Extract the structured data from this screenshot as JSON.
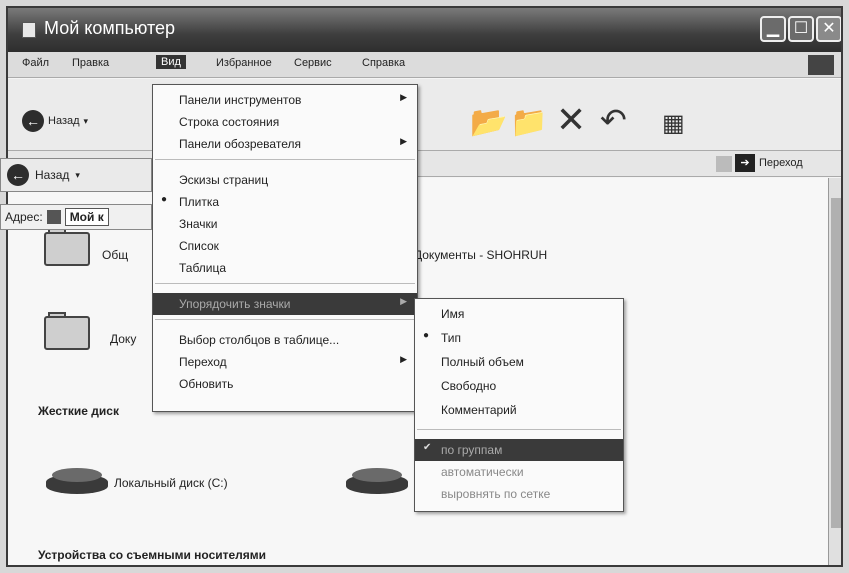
{
  "window": {
    "title": "Мой компьютер"
  },
  "menubar": {
    "items": [
      "Файл",
      "Правка",
      "Вид",
      "Избранное",
      "Сервис",
      "Справка"
    ],
    "active": "Вид"
  },
  "toolbar": {
    "back_label": "Назад"
  },
  "address": {
    "label": "Адрес:",
    "value": "Мой к",
    "go_label": "Переход"
  },
  "content": {
    "folder1": "Общ",
    "folder1_path": "Документы - SHOHRUH",
    "folder2": "Доку",
    "section_hdd": "Жесткие диск",
    "drive_c": "Локальный диск (C:)",
    "section_removable": "Устройства со съемными носителями"
  },
  "view_menu": {
    "group1": [
      {
        "label": "Панели инструментов",
        "submenu": true
      },
      {
        "label": "Строка состояния"
      },
      {
        "label": "Панели обозревателя",
        "submenu": true
      }
    ],
    "group2": [
      {
        "label": "Эскизы страниц"
      },
      {
        "label": "Плитка",
        "bullet": true
      },
      {
        "label": "Значки"
      },
      {
        "label": "Список"
      },
      {
        "label": "Таблица"
      }
    ],
    "group3": [
      {
        "label": "Упорядочить значки",
        "submenu": true,
        "highlighted": true
      }
    ],
    "group4": [
      {
        "label": "Выбор столбцов в таблице..."
      },
      {
        "label": "Переход",
        "submenu": true
      },
      {
        "label": "Обновить"
      }
    ]
  },
  "arrange_menu": {
    "sort_items": [
      {
        "label": "Имя"
      },
      {
        "label": "Тип",
        "bullet": true
      },
      {
        "label": "Полный объем"
      },
      {
        "label": "Свободно"
      },
      {
        "label": "Комментарий"
      }
    ],
    "option_items": [
      {
        "label": "по группам",
        "checked": true,
        "highlighted": true
      },
      {
        "label": "автоматически"
      },
      {
        "label": "выровнять по сетке"
      }
    ]
  },
  "glyphs": {
    "bullet": "●",
    "check": "✔",
    "submenu_arrow": "▶",
    "back_arrow": "←",
    "go_arrow": "➔"
  }
}
